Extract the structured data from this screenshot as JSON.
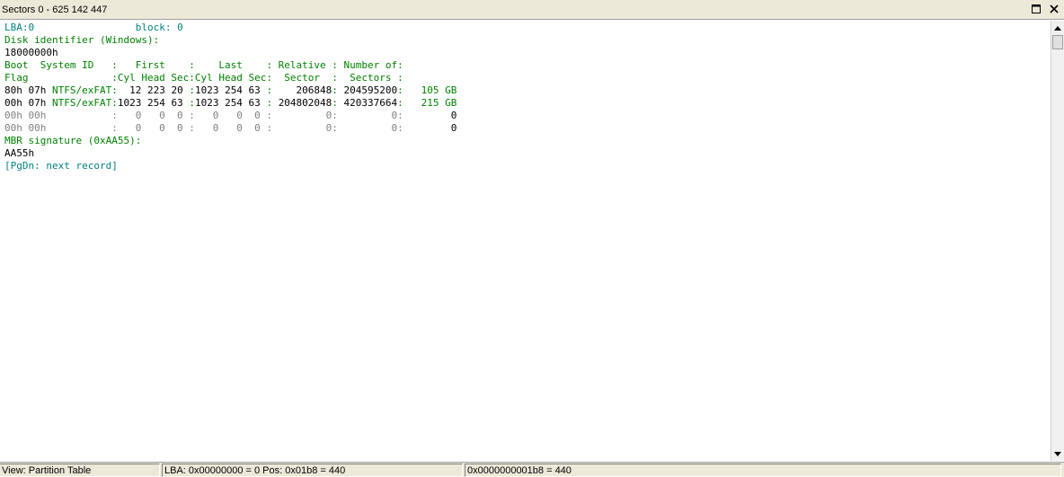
{
  "window": {
    "title": "Sectors 0 - 625 142 447"
  },
  "colors": {
    "teal": "#008080",
    "green": "#008000",
    "black": "#000000",
    "gray": "#808080"
  },
  "lines": [
    [
      {
        "t": "LBA:0",
        "c": "teal"
      },
      {
        "t": "                 ",
        "c": "black"
      },
      {
        "t": "block: 0",
        "c": "teal"
      }
    ],
    [
      {
        "t": "Disk identifier (Windows):",
        "c": "green"
      }
    ],
    [
      {
        "t": "18000000h",
        "c": "black"
      }
    ],
    [
      {
        "t": "Boot  System ID   :   First    :    Last    : Relative : Number of:",
        "c": "green"
      }
    ],
    [
      {
        "t": "Flag              :Cyl Head Sec:Cyl Head Sec:  Sector  :  Sectors :",
        "c": "green"
      }
    ],
    [
      {
        "t": "80h 07h",
        "c": "black"
      },
      {
        "t": " NTFS/exFAT:",
        "c": "green"
      },
      {
        "t": "  12 223 20 ",
        "c": "black"
      },
      {
        "t": ":",
        "c": "green"
      },
      {
        "t": "1023 254 63 ",
        "c": "black"
      },
      {
        "t": ":",
        "c": "green"
      },
      {
        "t": "    206848",
        "c": "black"
      },
      {
        "t": ": ",
        "c": "green"
      },
      {
        "t": "204595200",
        "c": "black"
      },
      {
        "t": ":   ",
        "c": "green"
      },
      {
        "t": "105 GB",
        "c": "green"
      }
    ],
    [
      {
        "t": "00h 07h",
        "c": "black"
      },
      {
        "t": " NTFS/exFAT:",
        "c": "green"
      },
      {
        "t": "1023 254 63 ",
        "c": "black"
      },
      {
        "t": ":",
        "c": "green"
      },
      {
        "t": "1023 254 63 ",
        "c": "black"
      },
      {
        "t": ": ",
        "c": "green"
      },
      {
        "t": "204802048",
        "c": "black"
      },
      {
        "t": ": ",
        "c": "green"
      },
      {
        "t": "420337664",
        "c": "black"
      },
      {
        "t": ":   ",
        "c": "green"
      },
      {
        "t": "215 GB",
        "c": "green"
      }
    ],
    [
      {
        "t": "00h 00h           :   0   0  0 :   0   0  0 :         0:         0:        ",
        "c": "gray"
      },
      {
        "t": "0",
        "c": "black"
      }
    ],
    [
      {
        "t": "00h 00h           :   0   0  0 :   0   0  0 :         0:         0:        ",
        "c": "gray"
      },
      {
        "t": "0",
        "c": "black"
      }
    ],
    [
      {
        "t": "MBR signature (0xAA55):",
        "c": "green"
      }
    ],
    [
      {
        "t": "AA55h",
        "c": "black"
      }
    ],
    [
      {
        "t": "[PgDn: next record]",
        "c": "teal"
      }
    ]
  ],
  "status": {
    "view": "View: Partition Table",
    "lba": "LBA: 0x00000000 = 0  Pos: 0x01b8 = 440",
    "offset": "0x0000000001b8 = 440"
  }
}
